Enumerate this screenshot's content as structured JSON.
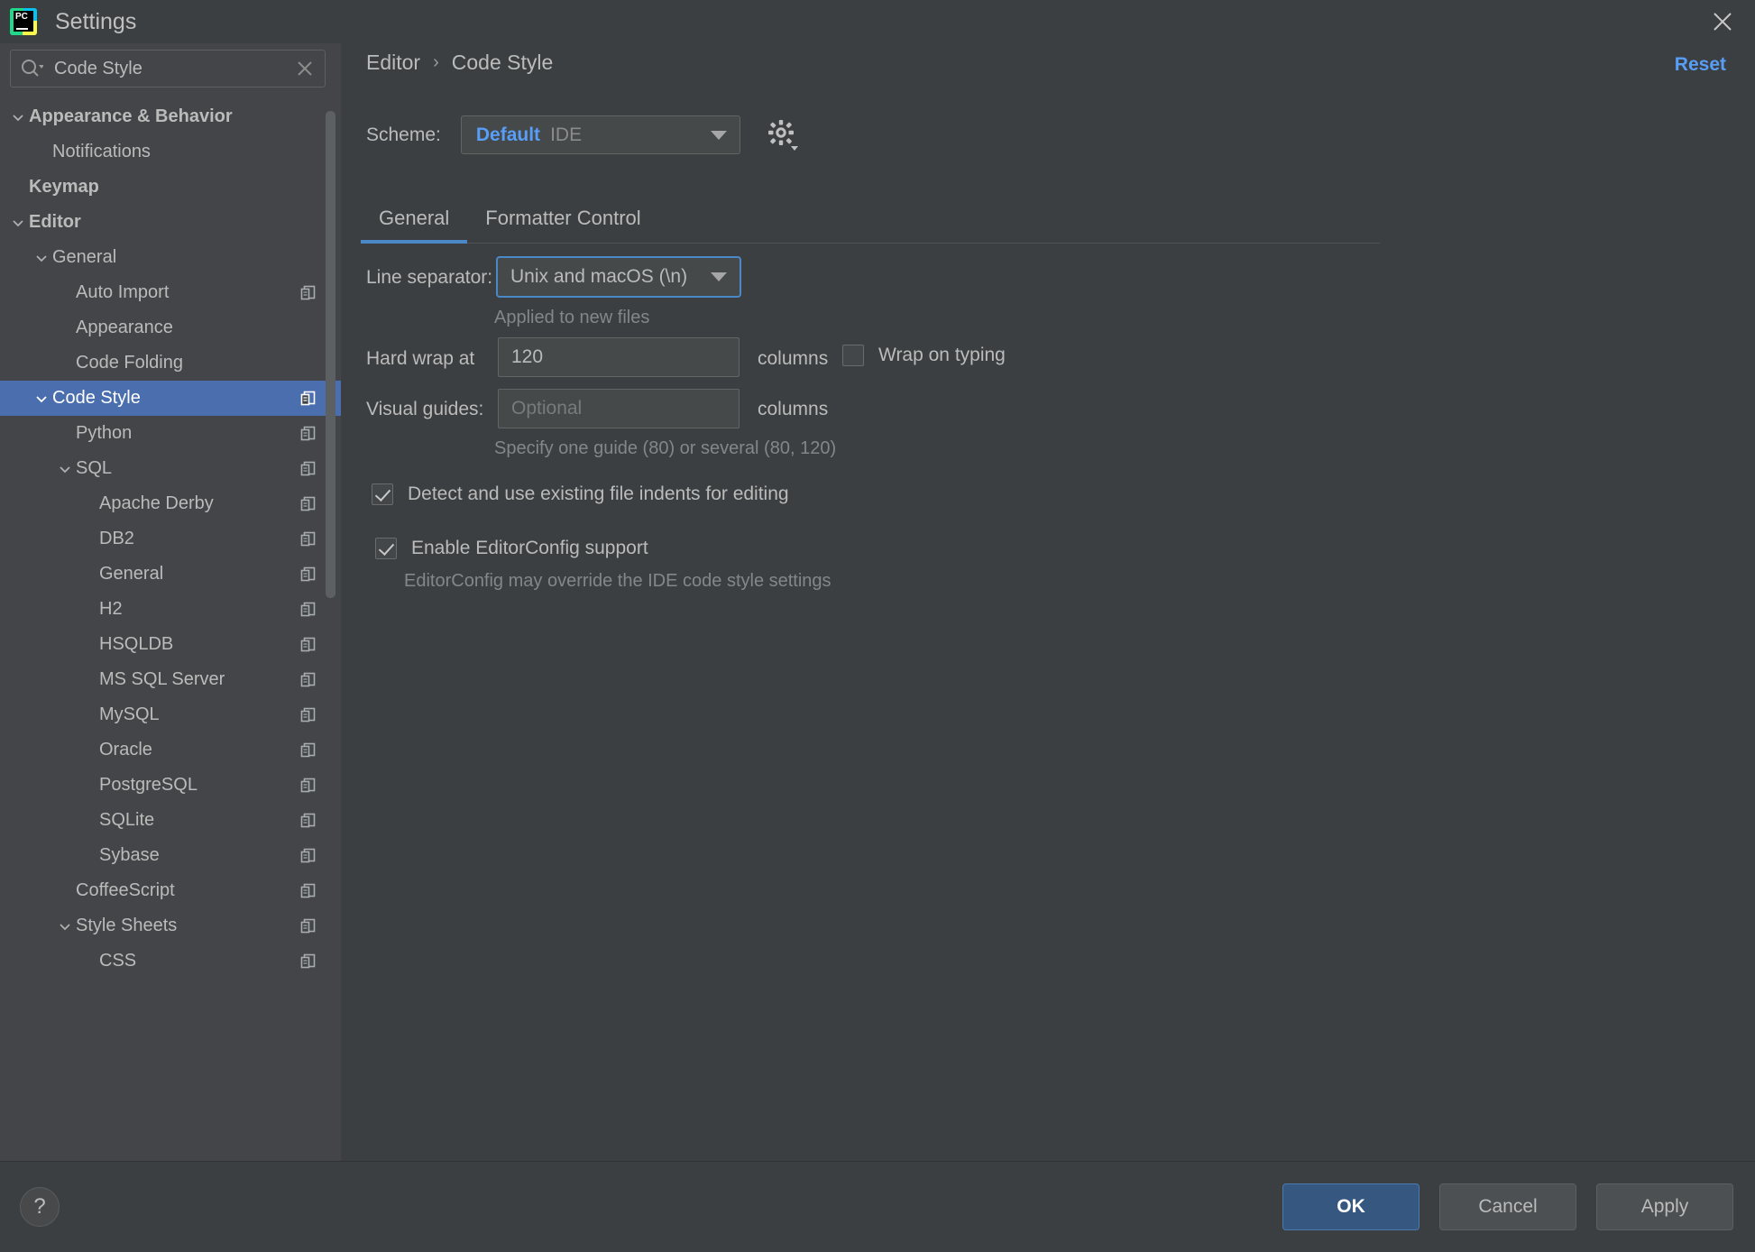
{
  "window": {
    "title": "Settings",
    "logo_text": "PC",
    "close_icon": "close-icon"
  },
  "search": {
    "value": "Code Style",
    "placeholder": "Search settings",
    "icon": "search-icon",
    "clear_icon": "clear-icon"
  },
  "sidebar": {
    "items": [
      {
        "label": "Appearance & Behavior",
        "indent": 0,
        "bold": true,
        "chevron": "down",
        "copy": false,
        "selected": false
      },
      {
        "label": "Notifications",
        "indent": 1,
        "bold": false,
        "chevron": "none",
        "copy": false,
        "selected": false
      },
      {
        "label": "Keymap",
        "indent": 0,
        "bold": true,
        "chevron": "none",
        "copy": false,
        "selected": false
      },
      {
        "label": "Editor",
        "indent": 0,
        "bold": true,
        "chevron": "down",
        "copy": false,
        "selected": false
      },
      {
        "label": "General",
        "indent": 1,
        "bold": false,
        "chevron": "down",
        "copy": false,
        "selected": false
      },
      {
        "label": "Auto Import",
        "indent": 2,
        "bold": false,
        "chevron": "none",
        "copy": true,
        "selected": false
      },
      {
        "label": "Appearance",
        "indent": 2,
        "bold": false,
        "chevron": "none",
        "copy": false,
        "selected": false
      },
      {
        "label": "Code Folding",
        "indent": 2,
        "bold": false,
        "chevron": "none",
        "copy": false,
        "selected": false
      },
      {
        "label": "Code Style",
        "indent": 1,
        "bold": false,
        "chevron": "down",
        "copy": true,
        "selected": true
      },
      {
        "label": "Python",
        "indent": 2,
        "bold": false,
        "chevron": "none",
        "copy": true,
        "selected": false
      },
      {
        "label": "SQL",
        "indent": 2,
        "bold": false,
        "chevron": "down",
        "copy": true,
        "selected": false
      },
      {
        "label": "Apache Derby",
        "indent": 3,
        "bold": false,
        "chevron": "none",
        "copy": true,
        "selected": false
      },
      {
        "label": "DB2",
        "indent": 3,
        "bold": false,
        "chevron": "none",
        "copy": true,
        "selected": false
      },
      {
        "label": "General",
        "indent": 3,
        "bold": false,
        "chevron": "none",
        "copy": true,
        "selected": false
      },
      {
        "label": "H2",
        "indent": 3,
        "bold": false,
        "chevron": "none",
        "copy": true,
        "selected": false
      },
      {
        "label": "HSQLDB",
        "indent": 3,
        "bold": false,
        "chevron": "none",
        "copy": true,
        "selected": false
      },
      {
        "label": "MS SQL Server",
        "indent": 3,
        "bold": false,
        "chevron": "none",
        "copy": true,
        "selected": false
      },
      {
        "label": "MySQL",
        "indent": 3,
        "bold": false,
        "chevron": "none",
        "copy": true,
        "selected": false
      },
      {
        "label": "Oracle",
        "indent": 3,
        "bold": false,
        "chevron": "none",
        "copy": true,
        "selected": false
      },
      {
        "label": "PostgreSQL",
        "indent": 3,
        "bold": false,
        "chevron": "none",
        "copy": true,
        "selected": false
      },
      {
        "label": "SQLite",
        "indent": 3,
        "bold": false,
        "chevron": "none",
        "copy": true,
        "selected": false
      },
      {
        "label": "Sybase",
        "indent": 3,
        "bold": false,
        "chevron": "none",
        "copy": true,
        "selected": false
      },
      {
        "label": "CoffeeScript",
        "indent": 2,
        "bold": false,
        "chevron": "none",
        "copy": true,
        "selected": false
      },
      {
        "label": "Style Sheets",
        "indent": 2,
        "bold": false,
        "chevron": "down",
        "copy": true,
        "selected": false
      },
      {
        "label": "CSS",
        "indent": 3,
        "bold": false,
        "chevron": "none",
        "copy": true,
        "selected": false
      }
    ]
  },
  "main": {
    "breadcrumb": {
      "root": "Editor",
      "separator": "›",
      "leaf": "Code Style"
    },
    "reset_label": "Reset",
    "scheme": {
      "label": "Scheme:",
      "name": "Default",
      "kind": "IDE",
      "gear_icon": "gear-icon"
    },
    "tabs": [
      {
        "label": "General",
        "active": true
      },
      {
        "label": "Formatter Control",
        "active": false
      }
    ],
    "form": {
      "line_separator_label": "Line separator:",
      "line_separator_value": "Unix and macOS (\\n)",
      "line_separator_hint": "Applied to new files",
      "hard_wrap_label": "Hard wrap at",
      "hard_wrap_value": "120",
      "hard_wrap_unit": "columns",
      "wrap_on_typing_label": "Wrap on typing",
      "wrap_on_typing_checked": false,
      "visual_guides_label": "Visual guides:",
      "visual_guides_value": "",
      "visual_guides_placeholder": "Optional",
      "visual_guides_unit": "columns",
      "visual_guides_hint": "Specify one guide (80) or several (80, 120)",
      "detect_indents_label": "Detect and use existing file indents for editing",
      "detect_indents_checked": true,
      "editorconfig_label": "Enable EditorConfig support",
      "editorconfig_checked": true,
      "editorconfig_hint": "EditorConfig may override the IDE code style settings"
    }
  },
  "footer": {
    "help_label": "?",
    "ok_label": "OK",
    "cancel_label": "Cancel",
    "apply_label": "Apply"
  },
  "colors": {
    "accent_blue": "#589df6",
    "selection_blue": "#4b6eaf",
    "primary_button": "#365880",
    "window_bg": "#3c3f41",
    "sidebar_bg": "#434548",
    "field_bg": "#45494a",
    "text": "#bbbbbb",
    "muted_text": "#82878a"
  }
}
